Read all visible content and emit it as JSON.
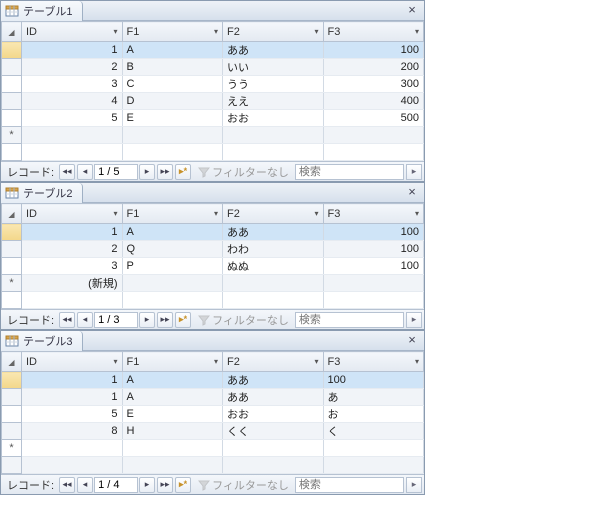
{
  "sheets": [
    {
      "title": "テーブル1",
      "columns": [
        "ID",
        "F1",
        "F2",
        "F3"
      ],
      "col_align": [
        "num",
        "txt",
        "txt",
        "num"
      ],
      "rows": [
        {
          "cells": [
            "1",
            "A",
            "ああ",
            "100"
          ],
          "selected": true
        },
        {
          "cells": [
            "2",
            "B",
            "いい",
            "200"
          ]
        },
        {
          "cells": [
            "3",
            "C",
            "うう",
            "300"
          ]
        },
        {
          "cells": [
            "4",
            "D",
            "ええ",
            "400"
          ]
        },
        {
          "cells": [
            "5",
            "E",
            "おお",
            "500"
          ]
        }
      ],
      "new_row_marker": "*",
      "extra_blank_rows": 1,
      "record_label": "レコード:",
      "record_pos": "1 / 5",
      "filter_label": "フィルターなし",
      "search_placeholder": "検索"
    },
    {
      "title": "テーブル2",
      "columns": [
        "ID",
        "F1",
        "F2",
        "F3"
      ],
      "col_align": [
        "num",
        "txt",
        "txt",
        "num"
      ],
      "rows": [
        {
          "cells": [
            "1",
            "A",
            "ああ",
            "100"
          ],
          "selected": true
        },
        {
          "cells": [
            "2",
            "Q",
            "わわ",
            "100"
          ]
        },
        {
          "cells": [
            "3",
            "P",
            "ぬぬ",
            "100"
          ]
        }
      ],
      "new_row_marker": "*",
      "new_row_text": "(新規)",
      "extra_blank_rows": 1,
      "record_label": "レコード:",
      "record_pos": "1 / 3",
      "filter_label": "フィルターなし",
      "search_placeholder": "検索"
    },
    {
      "title": "テーブル3",
      "columns": [
        "ID",
        "F1",
        "F2",
        "F3"
      ],
      "col_align": [
        "num",
        "txt",
        "txt",
        "txt"
      ],
      "rows": [
        {
          "cells": [
            "1",
            "A",
            "ああ",
            "100"
          ],
          "selected": true
        },
        {
          "cells": [
            "1",
            "A",
            "ああ",
            "あ"
          ]
        },
        {
          "cells": [
            "5",
            "E",
            "おお",
            "お"
          ]
        },
        {
          "cells": [
            "8",
            "H",
            "くく",
            "く"
          ]
        }
      ],
      "new_row_marker": "*",
      "extra_blank_rows": 1,
      "record_label": "レコード:",
      "record_pos": "1 / 4",
      "filter_label": "フィルターなし",
      "search_placeholder": "検索"
    }
  ]
}
